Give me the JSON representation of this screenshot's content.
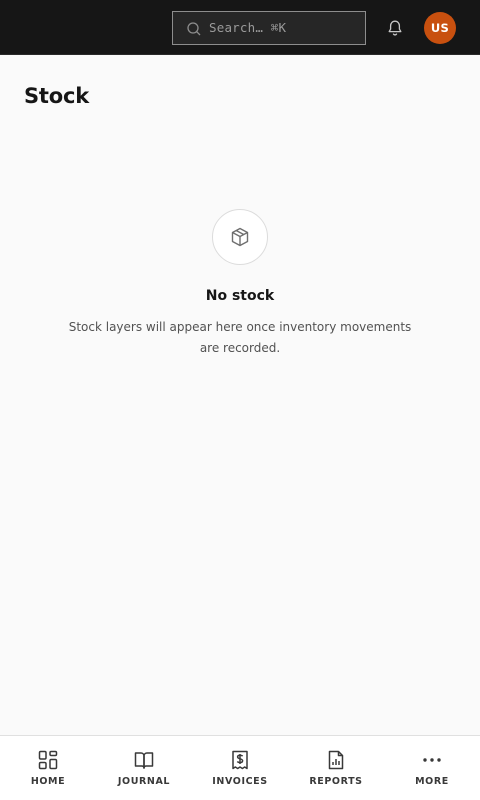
{
  "header": {
    "search": {
      "placeholder": "Search… ⌘K",
      "icon": "search-icon"
    },
    "notifications": {
      "icon": "bell-icon"
    },
    "avatar": {
      "initials": "US",
      "color": "#c8500f"
    }
  },
  "page": {
    "title": "Stock"
  },
  "empty_state": {
    "icon": "package-icon",
    "title": "No stock",
    "description": "Stock layers will appear here once inventory movements are recorded."
  },
  "bottom_nav": {
    "items": [
      {
        "label": "HOME",
        "icon": "dashboard-icon"
      },
      {
        "label": "JOURNAL",
        "icon": "book-icon"
      },
      {
        "label": "INVOICES",
        "icon": "invoice-icon"
      },
      {
        "label": "REPORTS",
        "icon": "report-icon"
      },
      {
        "label": "MORE",
        "icon": "more-icon"
      }
    ]
  },
  "colors": {
    "topbar": "#161616",
    "background": "#fafafa",
    "accent": "#c8500f"
  }
}
